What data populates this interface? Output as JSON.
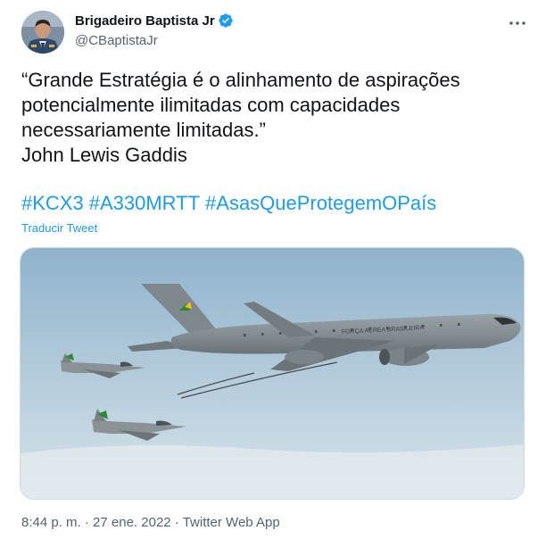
{
  "author": {
    "display_name": "Brigadeiro Baptista Jr",
    "handle": "@CBaptistaJr"
  },
  "icons": {
    "verified": "verified-badge-icon",
    "more": "more-options-icon"
  },
  "tweet": {
    "text": "“Grande Estratégia é o alinhamento de aspirações\npotencialmente ilimitadas com capacidades\nnecessariamente limitadas.”\nJohn Lewis Gaddis",
    "hashtags": [
      "#KCX3",
      "#A330MRTT",
      "#AsasQueProtegemOPaís"
    ],
    "translate_label": "Traducir Tweet"
  },
  "media": {
    "fuselage_text": "FORÇA AÉREA BRASILEIRA"
  },
  "meta": {
    "time": "8:44 p. m.",
    "separator": "·",
    "date": "27 ene. 2022",
    "source": "Twitter Web App"
  },
  "colors": {
    "link": "#1d9bf0",
    "secondary_text": "#536471",
    "primary_text": "#0f1419",
    "border": "#cfd9de"
  }
}
